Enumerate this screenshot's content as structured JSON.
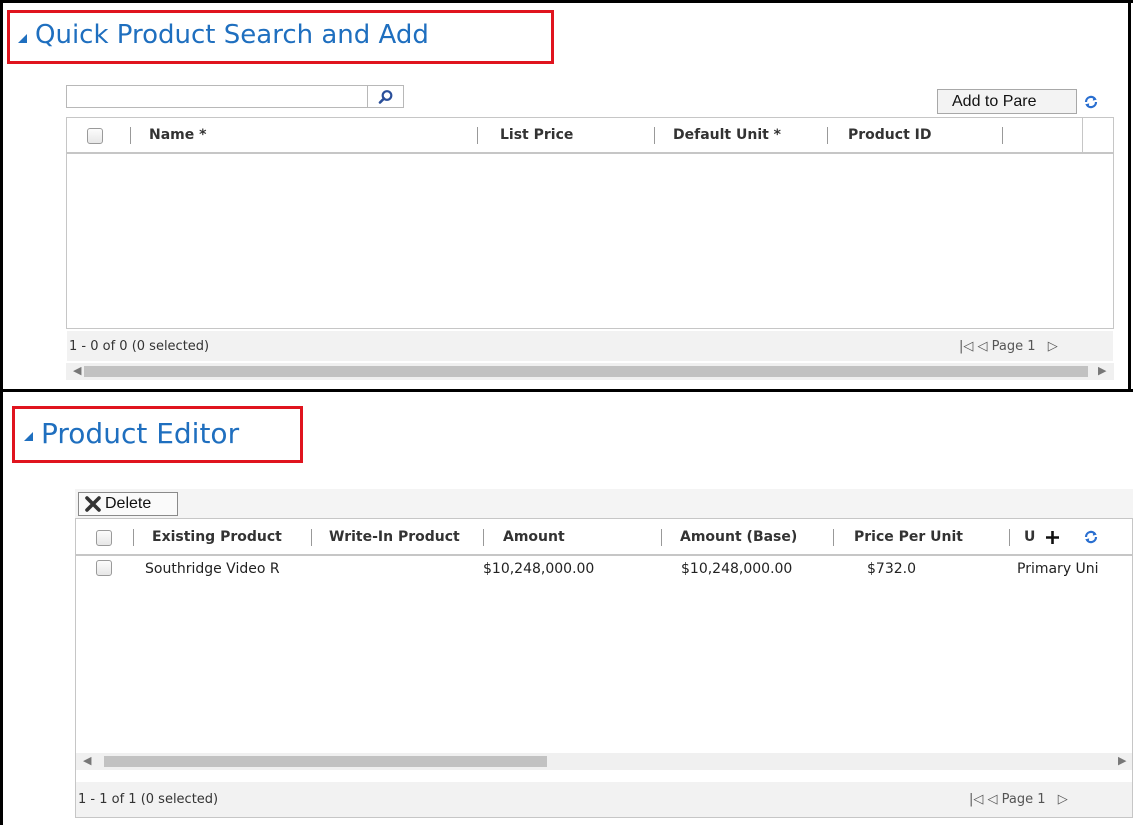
{
  "quick_search": {
    "title": "Quick Product Search and Add",
    "search": {
      "value": "",
      "placeholder": ""
    },
    "add_button_label": "Add to Pare",
    "columns": [
      "Name *",
      "List Price",
      "Default Unit *",
      "Product ID"
    ],
    "footer": {
      "count": "1 - 0 of 0 (0 selected)",
      "pager": "Page 1"
    }
  },
  "product_editor": {
    "title": "Product Editor",
    "delete_label": "Delete",
    "columns": [
      "Existing Product",
      "Write-In Product",
      "Amount",
      "Amount (Base)",
      "Price Per Unit",
      "U"
    ],
    "rows": [
      {
        "existing_product": "Southridge Video R",
        "write_in_product": "",
        "amount": "$10,248,000.00",
        "amount_base": "$10,248,000.00",
        "price_per_unit": "$732.0",
        "unit": "Primary Uni"
      }
    ],
    "footer": {
      "count": "1 - 1 of 1 (0 selected)",
      "pager": "Page 1"
    }
  },
  "colors": {
    "accent": "#1f6fbf",
    "highlight": "#e0141e",
    "frame": "#000000"
  },
  "icons": [
    "search-icon",
    "refresh-icon",
    "delete-x-icon",
    "plus-icon",
    "pager-first-icon",
    "pager-prev-icon",
    "pager-next-icon",
    "section-collapse-icon"
  ]
}
